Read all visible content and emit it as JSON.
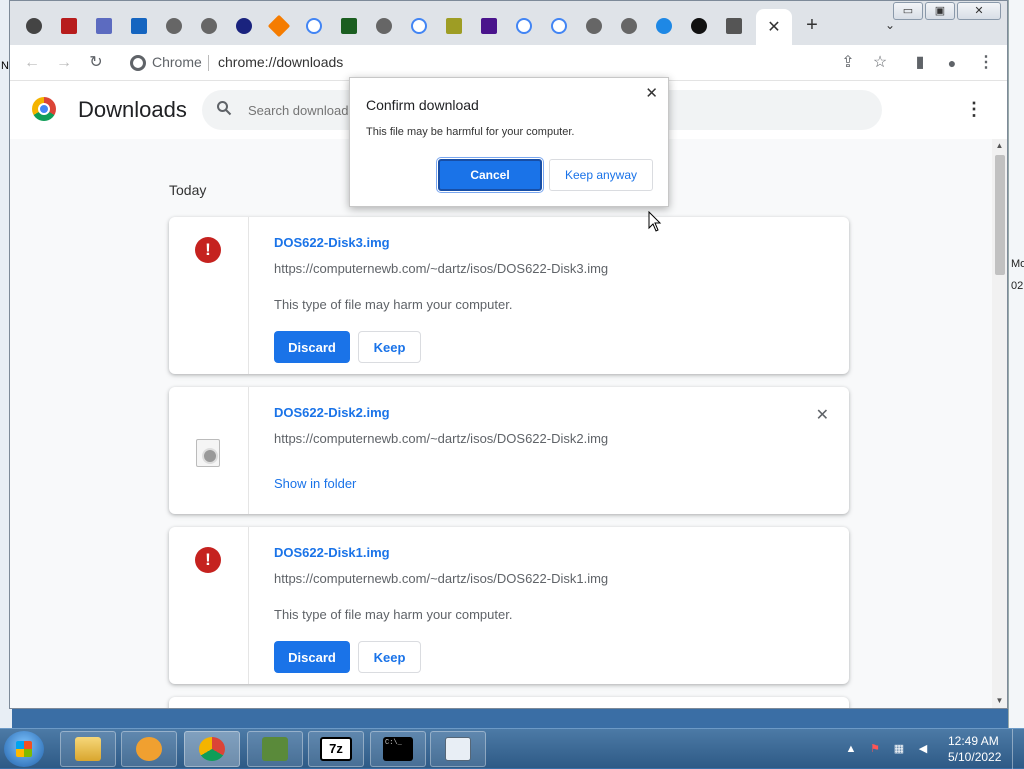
{
  "desktop": {
    "right_fragments": [
      "Mo",
      "02"
    ],
    "left_fragment": "N"
  },
  "window": {
    "tab_close_glyph": "✕",
    "new_tab_glyph": "+",
    "tab_search_glyph": "⌄",
    "minimize_glyph": "▭",
    "maximize_glyph": "▣",
    "close_glyph": "✕"
  },
  "toolbar": {
    "back_glyph": "←",
    "forward_glyph": "→",
    "reload_glyph": "↻",
    "site_label": "Chrome",
    "url": "chrome://downloads",
    "share_glyph": "⇪",
    "bookmark_glyph": "☆",
    "sidepanel_glyph": "▮",
    "profile_glyph": "●",
    "menu_glyph": "⋮"
  },
  "page": {
    "title": "Downloads",
    "search_placeholder": "Search downloads",
    "menu_glyph": "⋮",
    "section_label": "Today"
  },
  "downloads": [
    {
      "file_name": "DOS622-Disk3.img",
      "url": "https://computernewb.com/~dartz/isos/DOS622-Disk3.img",
      "warning": "This type of file may harm your computer.",
      "discard_label": "Discard",
      "keep_label": "Keep"
    },
    {
      "file_name": "DOS622-Disk2.img",
      "url": "https://computernewb.com/~dartz/isos/DOS622-Disk2.img",
      "show_in_folder_label": "Show in folder",
      "remove_glyph": "✕"
    },
    {
      "file_name": "DOS622-Disk1.img",
      "url": "https://computernewb.com/~dartz/isos/DOS622-Disk1.img",
      "warning": "This type of file may harm your computer.",
      "discard_label": "Discard",
      "keep_label": "Keep"
    }
  ],
  "dialog": {
    "title": "Confirm download",
    "message": "This file may be harmful for your computer.",
    "cancel_label": "Cancel",
    "keep_label": "Keep anyway",
    "close_glyph": "✕"
  },
  "taskbar": {
    "time": "12:49 AM",
    "date": "5/10/2022",
    "app_7z_label": "7z",
    "terminal_label": "C:\\_"
  },
  "colors": {
    "accent": "#1a73e8",
    "danger": "#c5221f"
  }
}
